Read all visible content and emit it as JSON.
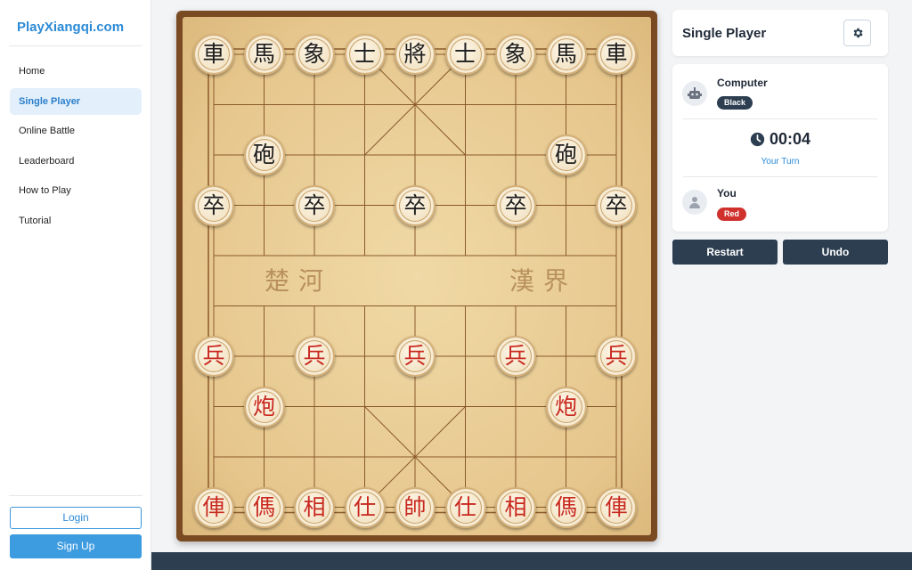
{
  "brand": {
    "logo_text": "PlayXiangqi.com"
  },
  "sidebar": {
    "items": [
      {
        "label": "Home",
        "active": false
      },
      {
        "label": "Single Player",
        "active": true
      },
      {
        "label": "Online Battle",
        "active": false
      },
      {
        "label": "Leaderboard",
        "active": false
      },
      {
        "label": "How to Play",
        "active": false
      },
      {
        "label": "Tutorial",
        "active": false
      }
    ],
    "login_label": "Login",
    "signup_label": "Sign Up"
  },
  "panel": {
    "title": "Single Player",
    "settings_icon": "gear-icon",
    "opponent": {
      "name": "Computer",
      "side": "Black",
      "icon": "robot-icon"
    },
    "timer": {
      "value": "00:04",
      "icon": "clock-icon"
    },
    "turn_label": "Your Turn",
    "player": {
      "name": "You",
      "side": "Red",
      "icon": "user-icon"
    },
    "restart_label": "Restart",
    "undo_label": "Undo"
  },
  "board": {
    "river_left": "楚河",
    "river_right": "漢界",
    "pieces": [
      {
        "char": "車",
        "side": "black",
        "file": 0,
        "rank": 0
      },
      {
        "char": "馬",
        "side": "black",
        "file": 1,
        "rank": 0
      },
      {
        "char": "象",
        "side": "black",
        "file": 2,
        "rank": 0
      },
      {
        "char": "士",
        "side": "black",
        "file": 3,
        "rank": 0
      },
      {
        "char": "將",
        "side": "black",
        "file": 4,
        "rank": 0
      },
      {
        "char": "士",
        "side": "black",
        "file": 5,
        "rank": 0
      },
      {
        "char": "象",
        "side": "black",
        "file": 6,
        "rank": 0
      },
      {
        "char": "馬",
        "side": "black",
        "file": 7,
        "rank": 0
      },
      {
        "char": "車",
        "side": "black",
        "file": 8,
        "rank": 0
      },
      {
        "char": "砲",
        "side": "black",
        "file": 1,
        "rank": 2
      },
      {
        "char": "砲",
        "side": "black",
        "file": 7,
        "rank": 2
      },
      {
        "char": "卒",
        "side": "black",
        "file": 0,
        "rank": 3
      },
      {
        "char": "卒",
        "side": "black",
        "file": 2,
        "rank": 3
      },
      {
        "char": "卒",
        "side": "black",
        "file": 4,
        "rank": 3
      },
      {
        "char": "卒",
        "side": "black",
        "file": 6,
        "rank": 3
      },
      {
        "char": "卒",
        "side": "black",
        "file": 8,
        "rank": 3
      },
      {
        "char": "兵",
        "side": "red",
        "file": 0,
        "rank": 6
      },
      {
        "char": "兵",
        "side": "red",
        "file": 2,
        "rank": 6
      },
      {
        "char": "兵",
        "side": "red",
        "file": 4,
        "rank": 6
      },
      {
        "char": "兵",
        "side": "red",
        "file": 6,
        "rank": 6
      },
      {
        "char": "兵",
        "side": "red",
        "file": 8,
        "rank": 6
      },
      {
        "char": "炮",
        "side": "red",
        "file": 1,
        "rank": 7
      },
      {
        "char": "炮",
        "side": "red",
        "file": 7,
        "rank": 7
      },
      {
        "char": "俥",
        "side": "red",
        "file": 0,
        "rank": 9
      },
      {
        "char": "傌",
        "side": "red",
        "file": 1,
        "rank": 9
      },
      {
        "char": "相",
        "side": "red",
        "file": 2,
        "rank": 9
      },
      {
        "char": "仕",
        "side": "red",
        "file": 3,
        "rank": 9
      },
      {
        "char": "帥",
        "side": "red",
        "file": 4,
        "rank": 9
      },
      {
        "char": "仕",
        "side": "red",
        "file": 5,
        "rank": 9
      },
      {
        "char": "相",
        "side": "red",
        "file": 6,
        "rank": 9
      },
      {
        "char": "傌",
        "side": "red",
        "file": 7,
        "rank": 9
      },
      {
        "char": "俥",
        "side": "red",
        "file": 8,
        "rank": 9
      }
    ]
  },
  "colors": {
    "accent": "#2b8ad6",
    "dark": "#2c3e50",
    "red": "#c8281e",
    "board_frame": "#7a4a22"
  }
}
